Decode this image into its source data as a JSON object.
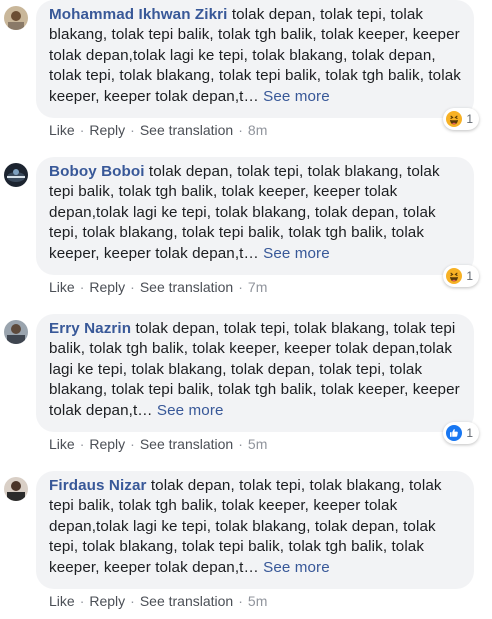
{
  "comments": [
    {
      "author": "Mohammad Ikhwan Zikri",
      "text": "tolak depan, tolak tepi, tolak blakang, tolak tepi balik, tolak tgh balik, tolak keeper, keeper tolak depan,tolak lagi ke tepi, tolak blakang, tolak depan, tolak tepi, tolak blakang, tolak tepi balik, tolak tgh balik, tolak keeper, keeper tolak depan,t…",
      "see_more": "See more",
      "actions": {
        "like": "Like",
        "reply": "Reply",
        "see_translation": "See translation",
        "time": "8m"
      },
      "reaction": {
        "icon": "haha-icon",
        "count": "1"
      }
    },
    {
      "author": "Boboy Boboi",
      "text": "tolak depan, tolak tepi, tolak blakang, tolak tepi balik, tolak tgh balik, tolak keeper, keeper tolak depan,tolak lagi ke tepi, tolak blakang, tolak depan, tolak tepi, tolak blakang, tolak tepi balik, tolak tgh balik, tolak keeper, keeper tolak depan,t…",
      "see_more": "See more",
      "actions": {
        "like": "Like",
        "reply": "Reply",
        "see_translation": "See translation",
        "time": "7m"
      },
      "reaction": {
        "icon": "haha-icon",
        "count": "1"
      }
    },
    {
      "author": "Erry Nazrin",
      "text": "tolak depan, tolak tepi, tolak blakang, tolak tepi balik, tolak tgh balik, tolak keeper, keeper tolak depan,tolak lagi ke tepi, tolak blakang, tolak depan, tolak tepi, tolak blakang, tolak tepi balik, tolak tgh balik, tolak keeper, keeper tolak depan,t…",
      "see_more": "See more",
      "actions": {
        "like": "Like",
        "reply": "Reply",
        "see_translation": "See translation",
        "time": "5m"
      },
      "reaction": {
        "icon": "like-icon",
        "count": "1"
      }
    },
    {
      "author": "Firdaus Nizar",
      "text": "tolak depan, tolak tepi, tolak blakang, tolak tepi balik, tolak tgh balik, tolak keeper, keeper tolak depan,tolak lagi ke tepi, tolak blakang, tolak depan, tolak tepi, tolak blakang, tolak tepi balik, tolak tgh balik, tolak keeper, keeper tolak depan,t…",
      "see_more": "See more",
      "actions": {
        "like": "Like",
        "reply": "Reply",
        "see_translation": "See translation",
        "time": "5m"
      }
    }
  ],
  "colors": {
    "author": "#385898",
    "bubble_bg": "#f2f3f5",
    "text": "#1c1e21",
    "action": "#4b4f56",
    "meta": "#90949c",
    "like_blue": "#1877f2",
    "haha_yellow": "#f7b125"
  }
}
